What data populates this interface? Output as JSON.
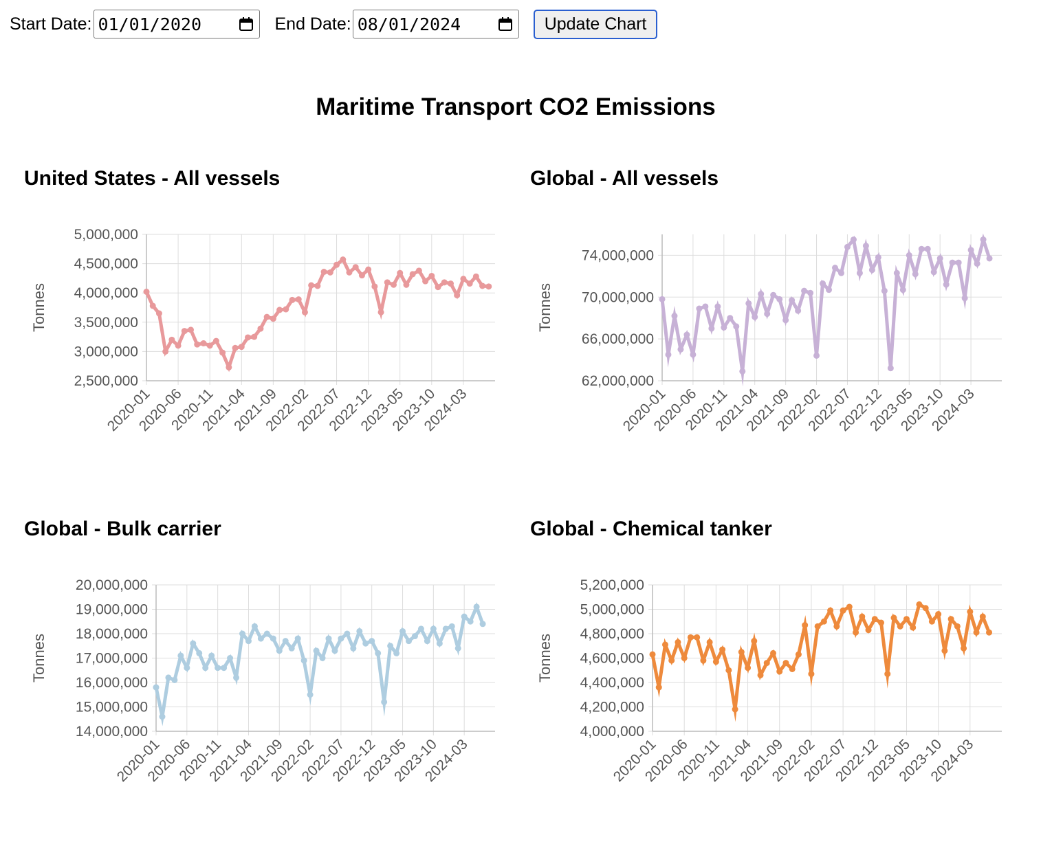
{
  "controls": {
    "start_label": "Start Date:",
    "start_value": "01/01/2020",
    "end_label": "End Date:",
    "end_value": "08/01/2024",
    "button_label": "Update Chart"
  },
  "title": "Maritime Transport CO2 Emissions",
  "chart_data": [
    {
      "type": "line",
      "title": "United States - All vessels",
      "ylabel": "Tonnes",
      "color": "#e8999b",
      "ylim": [
        2500000,
        5000000
      ],
      "yticks": [
        2500000,
        3000000,
        3500000,
        4000000,
        4500000,
        5000000
      ],
      "ytick_labels": [
        "2,500,000",
        "3,000,000",
        "3,500,000",
        "4,000,000",
        "4,500,000",
        "5,000,000"
      ],
      "xticks": [
        "2020-01",
        "2020-06",
        "2020-11",
        "2021-04",
        "2021-09",
        "2022-02",
        "2022-07",
        "2022-12",
        "2023-05",
        "2023-10",
        "2024-03"
      ],
      "x_start": "2020-01",
      "x_end": "2024-08",
      "values": [
        4020000,
        3780000,
        3650000,
        3000000,
        3200000,
        3100000,
        3350000,
        3370000,
        3120000,
        3140000,
        3100000,
        3180000,
        2980000,
        2730000,
        3060000,
        3080000,
        3240000,
        3250000,
        3390000,
        3590000,
        3560000,
        3710000,
        3720000,
        3880000,
        3890000,
        3670000,
        4130000,
        4120000,
        4360000,
        4350000,
        4480000,
        4570000,
        4350000,
        4440000,
        4300000,
        4400000,
        4110000,
        3670000,
        4180000,
        4140000,
        4340000,
        4140000,
        4320000,
        4380000,
        4200000,
        4290000,
        4100000,
        4180000,
        4160000,
        3960000,
        4240000,
        4160000,
        4280000,
        4120000,
        4110000
      ]
    },
    {
      "type": "line",
      "title": "Global - All vessels",
      "ylabel": "Tonnes",
      "color": "#c7b1d6",
      "ylim": [
        62000000,
        76000000
      ],
      "yticks": [
        62000000,
        66000000,
        70000000,
        74000000
      ],
      "ytick_labels": [
        "62,000,000",
        "66,000,000",
        "70,000,000",
        "74,000,000"
      ],
      "xticks": [
        "2020-01",
        "2020-06",
        "2020-11",
        "2021-04",
        "2021-09",
        "2022-02",
        "2022-07",
        "2022-12",
        "2023-05",
        "2023-10",
        "2024-03"
      ],
      "x_start": "2020-01",
      "x_end": "2024-08",
      "values": [
        69800000,
        64500000,
        68200000,
        65000000,
        66400000,
        64500000,
        68900000,
        69100000,
        67000000,
        69100000,
        67100000,
        68000000,
        67200000,
        62900000,
        69400000,
        68100000,
        70300000,
        68400000,
        70200000,
        69800000,
        67800000,
        69700000,
        68700000,
        70600000,
        70400000,
        64400000,
        71300000,
        70700000,
        72800000,
        72300000,
        74800000,
        75500000,
        72300000,
        74900000,
        72600000,
        73800000,
        70600000,
        63200000,
        72300000,
        70700000,
        74000000,
        72200000,
        74600000,
        74600000,
        72400000,
        73700000,
        71200000,
        73300000,
        73300000,
        69900000,
        74500000,
        73200000,
        75500000,
        73700000
      ]
    },
    {
      "type": "line",
      "title": "Global - Bulk carrier",
      "ylabel": "Tonnes",
      "color": "#aecde0",
      "ylim": [
        14000000,
        20000000
      ],
      "yticks": [
        14000000,
        15000000,
        16000000,
        17000000,
        18000000,
        19000000,
        20000000
      ],
      "ytick_labels": [
        "14,000,000",
        "15,000,000",
        "16,000,000",
        "17,000,000",
        "18,000,000",
        "19,000,000",
        "20,000,000"
      ],
      "xticks": [
        "2020-01",
        "2020-06",
        "2020-11",
        "2021-04",
        "2021-09",
        "2022-02",
        "2022-07",
        "2022-12",
        "2023-05",
        "2023-10",
        "2024-03"
      ],
      "x_start": "2020-01",
      "x_end": "2024-08",
      "values": [
        15800000,
        14600000,
        16200000,
        16100000,
        17100000,
        16600000,
        17600000,
        17200000,
        16600000,
        17100000,
        16600000,
        16600000,
        17000000,
        16200000,
        18000000,
        17700000,
        18300000,
        17800000,
        18000000,
        17800000,
        17300000,
        17700000,
        17400000,
        17800000,
        16900000,
        15500000,
        17300000,
        17000000,
        17800000,
        17300000,
        17800000,
        18000000,
        17400000,
        18100000,
        17600000,
        17700000,
        17200000,
        15200000,
        17500000,
        17200000,
        18100000,
        17700000,
        17900000,
        18200000,
        17700000,
        18200000,
        17600000,
        18200000,
        18300000,
        17400000,
        18700000,
        18500000,
        19100000,
        18400000
      ]
    },
    {
      "type": "line",
      "title": "Global - Chemical tanker",
      "ylabel": "Tonnes",
      "color": "#ee8a3c",
      "ylim": [
        4000000,
        5200000
      ],
      "yticks": [
        4000000,
        4200000,
        4400000,
        4600000,
        4800000,
        5000000,
        5200000
      ],
      "ytick_labels": [
        "4,000,000",
        "4,200,000",
        "4,400,000",
        "4,600,000",
        "4,800,000",
        "5,000,000",
        "5,200,000"
      ],
      "xticks": [
        "2020-01",
        "2020-06",
        "2020-11",
        "2021-04",
        "2021-09",
        "2022-02",
        "2022-07",
        "2022-12",
        "2023-05",
        "2023-10",
        "2024-03"
      ],
      "x_start": "2020-01",
      "x_end": "2024-08",
      "values": [
        4630000,
        4360000,
        4710000,
        4580000,
        4730000,
        4600000,
        4770000,
        4770000,
        4580000,
        4730000,
        4570000,
        4670000,
        4500000,
        4180000,
        4650000,
        4520000,
        4740000,
        4460000,
        4560000,
        4640000,
        4490000,
        4560000,
        4510000,
        4630000,
        4870000,
        4470000,
        4860000,
        4900000,
        4990000,
        4860000,
        4990000,
        5020000,
        4810000,
        4940000,
        4830000,
        4920000,
        4890000,
        4470000,
        4930000,
        4860000,
        4920000,
        4850000,
        5040000,
        5010000,
        4900000,
        4960000,
        4660000,
        4920000,
        4860000,
        4680000,
        4980000,
        4810000,
        4940000,
        4810000
      ]
    }
  ]
}
